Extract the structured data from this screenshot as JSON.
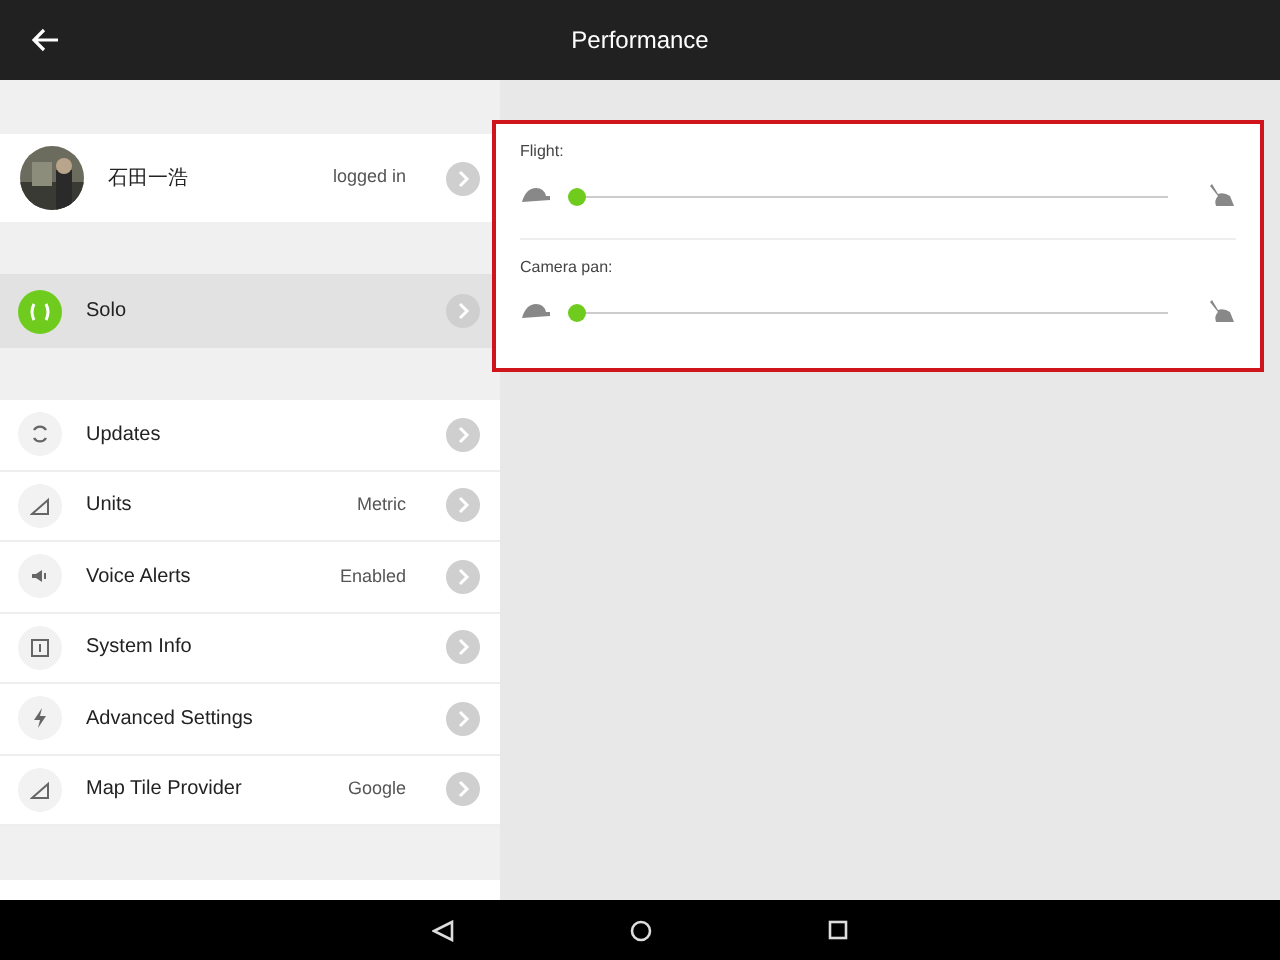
{
  "header": {
    "title": "Performance"
  },
  "profile": {
    "name": "石田一浩",
    "status": "logged in"
  },
  "vehicles": [
    {
      "label": "Solo",
      "selected": true
    }
  ],
  "settings": [
    {
      "label": "Updates"
    },
    {
      "label": "Units",
      "value": "Metric"
    },
    {
      "label": "Voice Alerts",
      "value": "Enabled"
    },
    {
      "label": "System Info"
    },
    {
      "label": "Advanced Settings"
    },
    {
      "label": "Map Tile Provider",
      "value": "Google"
    }
  ],
  "sliders": [
    {
      "label": "Flight:",
      "level": 0
    },
    {
      "label": "Camera pan:",
      "level": 0
    }
  ]
}
